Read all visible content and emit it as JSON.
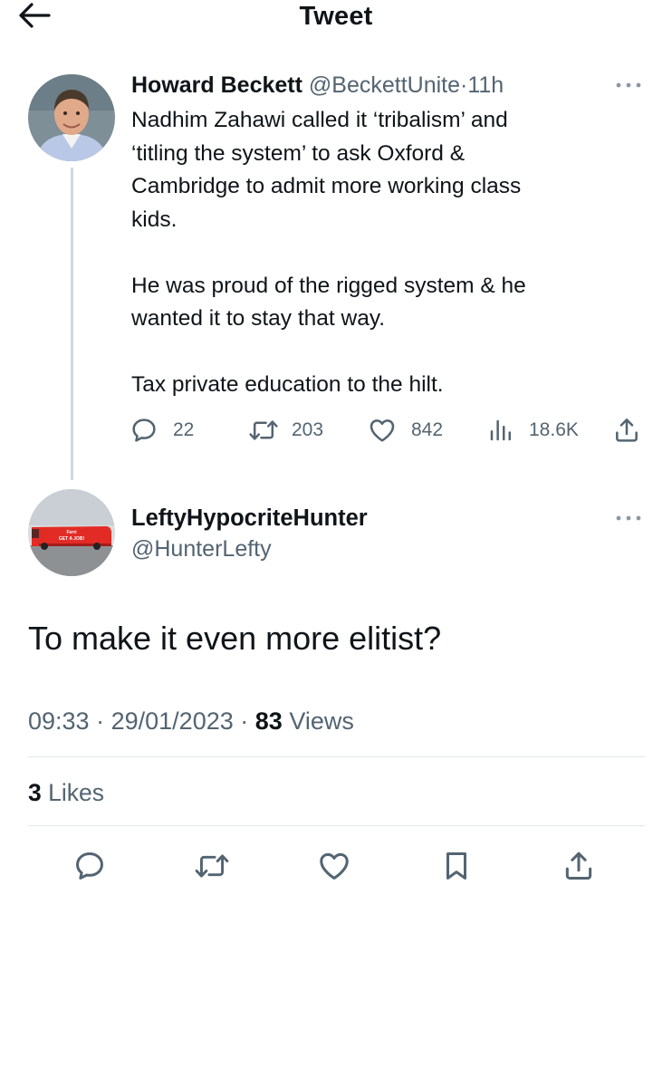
{
  "header": {
    "title": "Tweet"
  },
  "original_tweet": {
    "author_name": "Howard Beckett",
    "handle": "@BeckettUnite",
    "separator": "·",
    "time": "11h",
    "paragraphs": [
      [
        "Nadhim Zahawi called it ‘tribalism’ and",
        "‘titling the system’ to ask Oxford &",
        "Cambridge to admit more working class",
        "kids."
      ],
      [
        "He was proud of the rigged system & he",
        "wanted it to stay that way."
      ],
      [
        "Tax private education to the hilt."
      ]
    ],
    "stats": {
      "replies": "22",
      "retweets": "203",
      "likes": "842",
      "views": "18.6K"
    }
  },
  "reply": {
    "author_name": "LeftyHypocriteHunter",
    "handle": "@HunterLefty",
    "avatar_bus_text": [
      "Ferri",
      "GET A JOB!"
    ],
    "text": "To make it even more elitist?",
    "time": "09:33",
    "date": "29/01/2023",
    "separator": "·",
    "views_count": "83",
    "views_label": "Views",
    "likes_count": "3",
    "likes_label": "Likes"
  },
  "icons": {
    "back": "arrow-left-icon",
    "more": "ellipsis-icon",
    "reply": "speech-bubble-icon",
    "retweet": "retweet-icon",
    "like": "heart-icon",
    "views": "bar-chart-icon",
    "share": "share-upload-icon",
    "bookmark": "bookmark-icon"
  },
  "colors": {
    "text": "#0f1419",
    "secondary": "#536471",
    "divider": "#e3e7ea",
    "thread_line": "#cfd9de"
  }
}
